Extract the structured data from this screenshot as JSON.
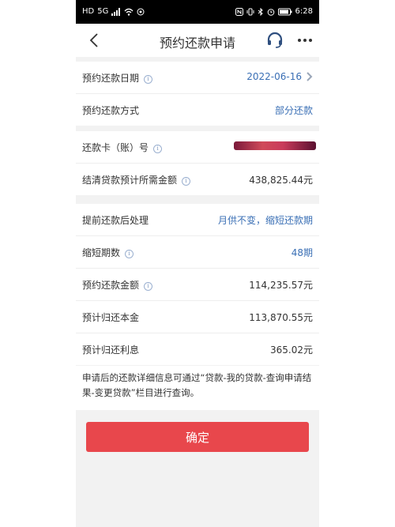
{
  "status": {
    "left_icons": [
      "HD",
      "5G"
    ],
    "time": "6:28"
  },
  "nav": {
    "title": "预约还款申请"
  },
  "section1": [
    {
      "label": "预约还款日期",
      "value": "2022-06-16"
    },
    {
      "label": "预约还款方式",
      "value": "部分还款"
    }
  ],
  "section2": [
    {
      "label": "还款卡（账）号",
      "value": ""
    },
    {
      "label": "结清贷款预计所需金额",
      "value": "438,825.44元"
    }
  ],
  "section3": [
    {
      "label": "提前还款后处理",
      "value": "月供不变，缩短还款期"
    },
    {
      "label": "缩短期数",
      "value": "48期"
    },
    {
      "label": "预约还款金额",
      "value": "114,235.57元"
    },
    {
      "label": "预计归还本金",
      "value": "113,870.55元"
    },
    {
      "label": "预计归还利息",
      "value": "365.02元"
    }
  ],
  "note": "申请后的还款详细信息可通过“贷款-我的贷款-查询申请结果-变更贷款”栏目进行查询。",
  "confirm_label": "确定",
  "colors": {
    "accent": "#3a6fb5",
    "button": "#e8474c"
  }
}
